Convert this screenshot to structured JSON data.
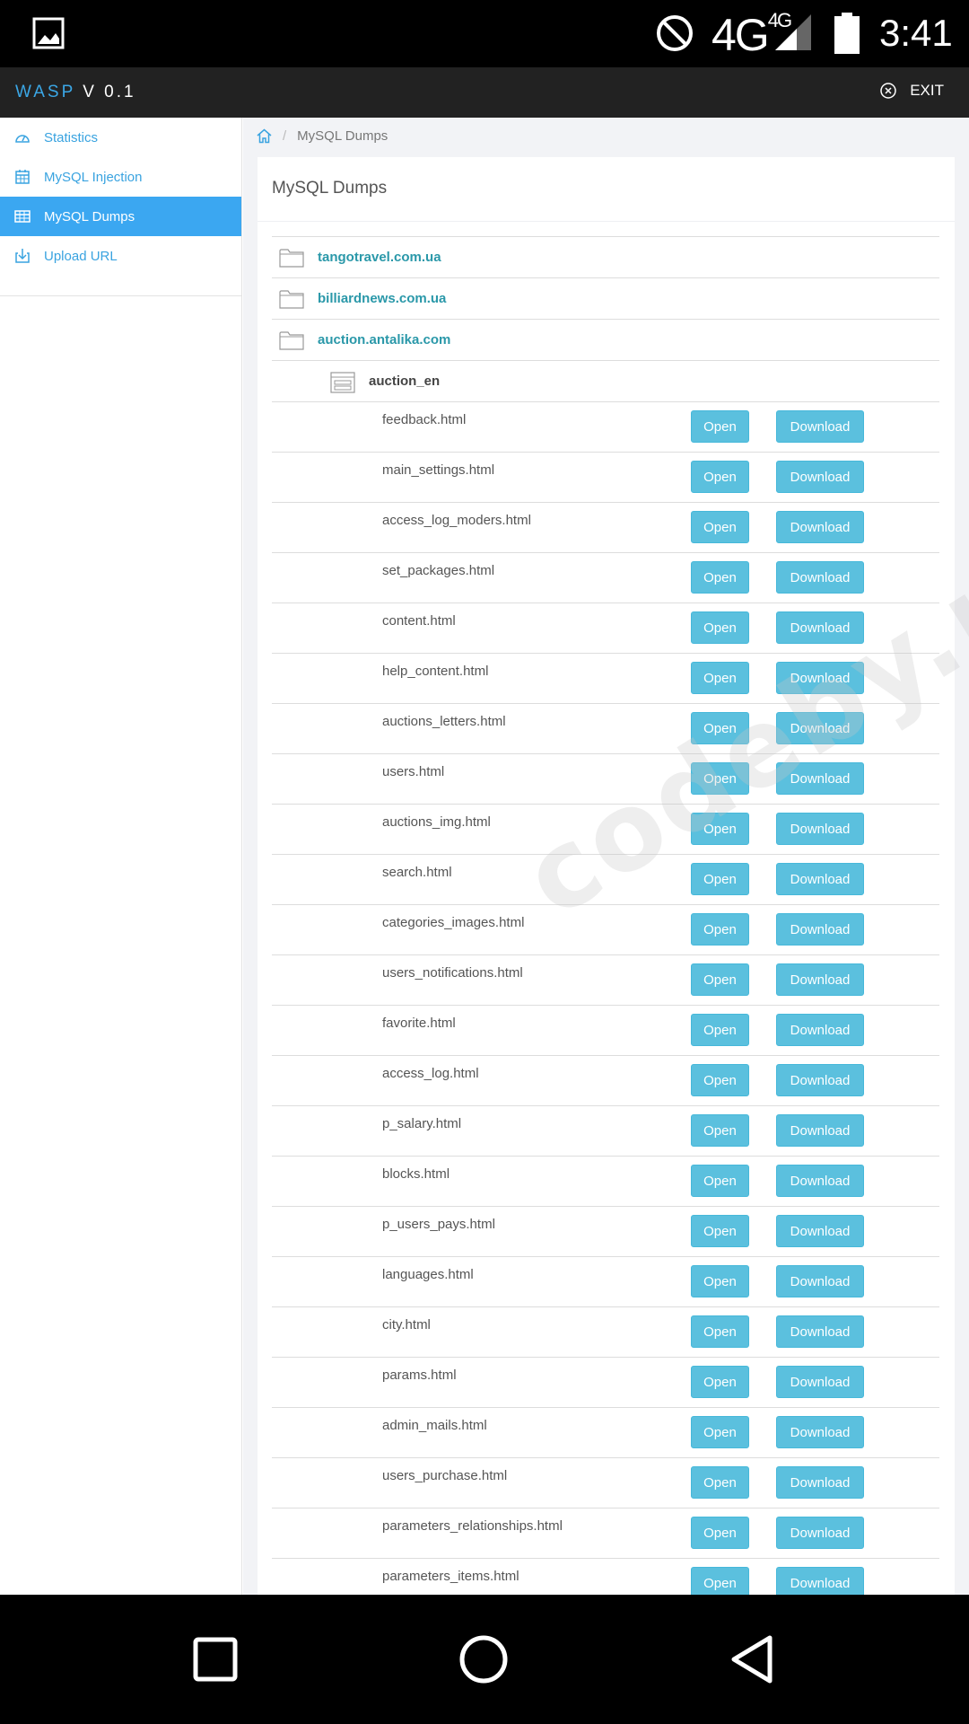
{
  "status_bar": {
    "network": "4G",
    "network_sup": "4G",
    "time": "3:41"
  },
  "app": {
    "brand_part1": "WASP",
    "brand_part2": "V 0.1",
    "exit_label": "EXIT"
  },
  "sidebar": {
    "items": [
      {
        "label": "Statistics",
        "icon": "dashboard-icon",
        "active": false
      },
      {
        "label": "MySQL Injection",
        "icon": "calendar-icon",
        "active": false
      },
      {
        "label": "MySQL Dumps",
        "icon": "table-icon",
        "active": true
      },
      {
        "label": "Upload URL",
        "icon": "download-box-icon",
        "active": false
      }
    ]
  },
  "breadcrumb": {
    "current": "MySQL Dumps",
    "separator": "/"
  },
  "card": {
    "title": "MySQL Dumps"
  },
  "folders": [
    {
      "label": "tangotravel.com.ua"
    },
    {
      "label": "billiardnews.com.ua"
    },
    {
      "label": "auction.antalika.com"
    }
  ],
  "table": {
    "label": "auction_en"
  },
  "buttons": {
    "open": "Open",
    "download": "Download"
  },
  "files": [
    "feedback.html",
    "main_settings.html",
    "access_log_moders.html",
    "set_packages.html",
    "content.html",
    "help_content.html",
    "auctions_letters.html",
    "users.html",
    "auctions_img.html",
    "search.html",
    "categories_images.html",
    "users_notifications.html",
    "favorite.html",
    "access_log.html",
    "p_salary.html",
    "blocks.html",
    "p_users_pays.html",
    "languages.html",
    "city.html",
    "params.html",
    "admin_mails.html",
    "users_purchase.html",
    "parameters_relationships.html",
    "parameters_items.html"
  ],
  "watermark": "codeby.net",
  "colors": {
    "accent": "#3ba7f1",
    "link": "#2a98a9",
    "button": "#5bc0de"
  }
}
